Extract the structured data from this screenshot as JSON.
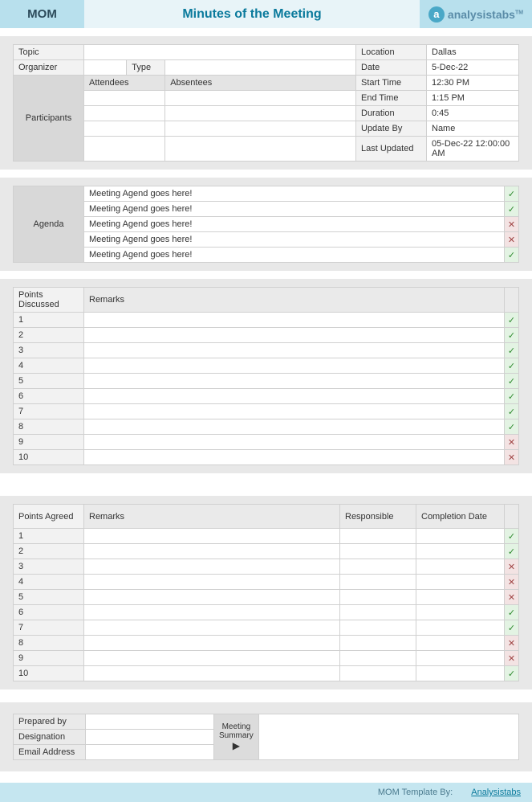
{
  "header": {
    "short": "MOM",
    "title": "Minutes of the Meeting",
    "brand": "analysistabs",
    "brand_icon": "a"
  },
  "meta": {
    "topic_label": "Topic",
    "topic": "",
    "location_label": "Location",
    "location": "Dallas",
    "organizer_label": "Organizer",
    "organizer": "",
    "type_label": "Type",
    "type": "",
    "date_label": "Date",
    "date": "5-Dec-22",
    "participants_label": "Participants",
    "attendees_label": "Attendees",
    "absentees_label": "Absentees",
    "start_time_label": "Start Time",
    "start_time": "12:30 PM",
    "end_time_label": "End Time",
    "end_time": "1:15 PM",
    "duration_label": "Duration",
    "duration": "0:45",
    "update_by_label": "Update By",
    "update_by": "Name",
    "last_updated_label": "Last Updated",
    "last_updated": "05-Dec-22 12:00:00 AM"
  },
  "agenda": {
    "label": "Agenda",
    "items": [
      {
        "text": "Meeting Agend goes here!",
        "ok": true
      },
      {
        "text": "Meeting Agend goes here!",
        "ok": true
      },
      {
        "text": "Meeting Agend goes here!",
        "ok": false
      },
      {
        "text": "Meeting Agend goes here!",
        "ok": false
      },
      {
        "text": "Meeting Agend goes here!",
        "ok": true
      }
    ]
  },
  "points": {
    "h1": "Points Discussed",
    "h2": "Remarks",
    "rows": [
      {
        "n": "1",
        "r": "",
        "ok": true
      },
      {
        "n": "2",
        "r": "",
        "ok": true
      },
      {
        "n": "3",
        "r": "",
        "ok": true
      },
      {
        "n": "4",
        "r": "",
        "ok": true
      },
      {
        "n": "5",
        "r": "",
        "ok": true
      },
      {
        "n": "6",
        "r": "",
        "ok": true
      },
      {
        "n": "7",
        "r": "",
        "ok": true
      },
      {
        "n": "8",
        "r": "",
        "ok": true
      },
      {
        "n": "9",
        "r": "",
        "ok": false
      },
      {
        "n": "10",
        "r": "",
        "ok": false
      }
    ]
  },
  "agreed": {
    "h1": "Points Agreed",
    "h2": "Remarks",
    "h3": "Responsible",
    "h4": "Completion Date",
    "rows": [
      {
        "n": "1",
        "r": "",
        "resp": "",
        "cd": "",
        "ok": true
      },
      {
        "n": "2",
        "r": "",
        "resp": "",
        "cd": "",
        "ok": true
      },
      {
        "n": "3",
        "r": "",
        "resp": "",
        "cd": "",
        "ok": false
      },
      {
        "n": "4",
        "r": "",
        "resp": "",
        "cd": "",
        "ok": false
      },
      {
        "n": "5",
        "r": "",
        "resp": "",
        "cd": "",
        "ok": false
      },
      {
        "n": "6",
        "r": "",
        "resp": "",
        "cd": "",
        "ok": true
      },
      {
        "n": "7",
        "r": "",
        "resp": "",
        "cd": "",
        "ok": true
      },
      {
        "n": "8",
        "r": "",
        "resp": "",
        "cd": "",
        "ok": false
      },
      {
        "n": "9",
        "r": "",
        "resp": "",
        "cd": "",
        "ok": false
      },
      {
        "n": "10",
        "r": "",
        "resp": "",
        "cd": "",
        "ok": true
      }
    ]
  },
  "footer": {
    "prepared_by_label": "Prepared by",
    "prepared_by": "",
    "designation_label": "Designation",
    "designation": "",
    "email_label": "Email Address",
    "email": "",
    "summary_label": "Meeting Summary",
    "summary": ""
  },
  "credit": {
    "text": "MOM Template By:",
    "link": "Analysistabs"
  },
  "marks": {
    "yes": "✓",
    "no": "✕"
  }
}
